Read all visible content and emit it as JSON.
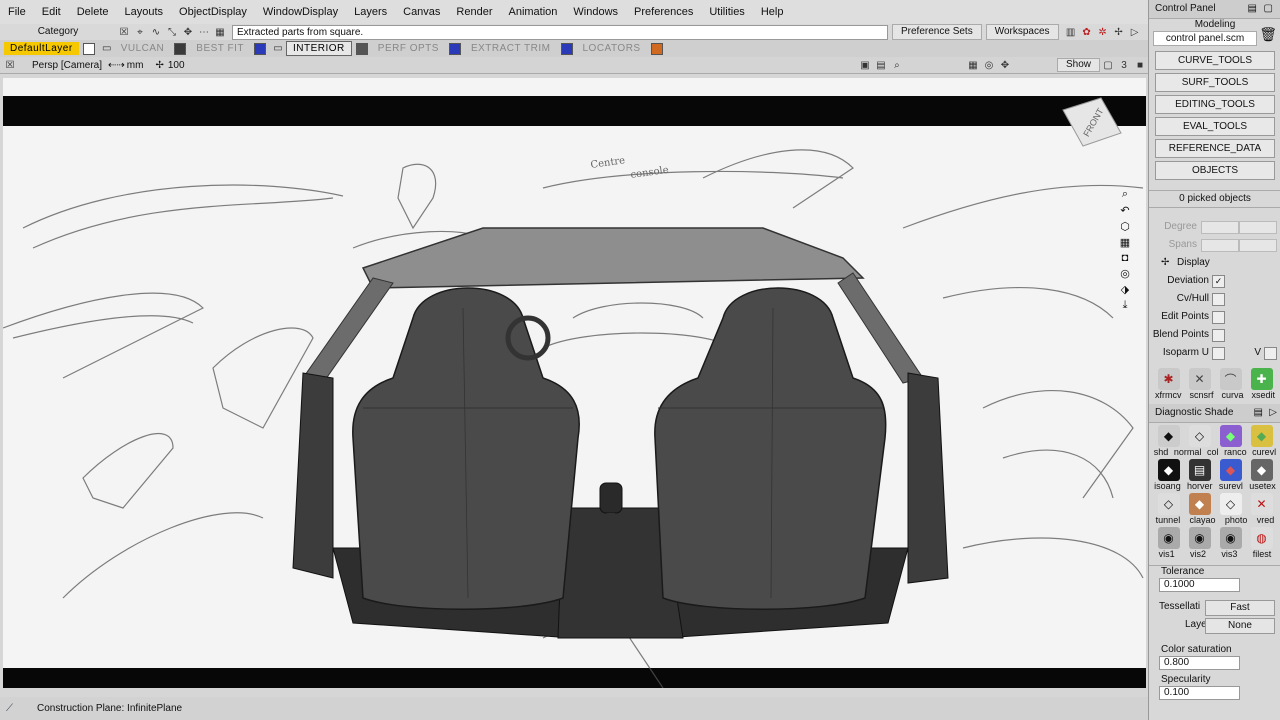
{
  "menu": [
    "File",
    "Edit",
    "Delete",
    "Layouts",
    "ObjectDisplay",
    "WindowDisplay",
    "Layers",
    "Canvas",
    "Render",
    "Animation",
    "Windows",
    "Preferences",
    "Utilities",
    "Help"
  ],
  "toolbar": {
    "category": "Category",
    "status_message": "Extracted parts from square.",
    "preference_sets": "Preference Sets",
    "workspaces": "Workspaces"
  },
  "layers": {
    "default": "DefaultLayer",
    "items": [
      {
        "label": "VULCAN",
        "color": "#3a3a3a"
      },
      {
        "label": "BEST FIT",
        "color": "#2a3ab8"
      },
      {
        "label": "INTERIOR",
        "color": "#555555"
      },
      {
        "label": "PERF OPTS",
        "color": "#2a3ab8"
      },
      {
        "label": "EXTRACT TRIM",
        "color": "#2a3ab8"
      },
      {
        "label": "LOCATORS",
        "color": "#d06a20"
      }
    ]
  },
  "viewport": {
    "camera": "Persp [Camera]",
    "units": "mm",
    "grid_value": "100",
    "show_label": "Show",
    "cube_label": "FRONT",
    "sketch_note_1": "Centre",
    "sketch_note_2": "console"
  },
  "statusbar": {
    "construction_plane": "Construction Plane: InfinitePlane"
  },
  "panel": {
    "title": "Control Panel",
    "mode": "Modeling",
    "file": "control panel.scm",
    "tool_buttons": [
      "CURVE_TOOLS",
      "SURF_TOOLS",
      "EDITING_TOOLS",
      "EVAL_TOOLS",
      "REFERENCE_DATA",
      "OBJECTS"
    ],
    "picked": "0 picked objects",
    "degree_label": "Degree",
    "spans_label": "Spans",
    "display_label": "Display",
    "display_rows": [
      {
        "label": "Deviation",
        "checked": true
      },
      {
        "label": "Cv/Hull",
        "checked": false
      },
      {
        "label": "Edit Points",
        "checked": false
      },
      {
        "label": "Blend Points",
        "checked": false
      },
      {
        "label": "Isoparm U",
        "checked": false
      }
    ],
    "isoparm_v": "V",
    "shelf1": [
      "xfrmcv",
      "scnsrf",
      "curva",
      "xsedit"
    ],
    "diag_title": "Diagnostic Shade",
    "diag_row1": [
      "shd",
      "normal",
      "col",
      "ranco",
      "curevl"
    ],
    "diag_row2": [
      "isoang",
      "horver",
      "surevl",
      "usetex"
    ],
    "diag_row3": [
      "tunnel",
      "clayao",
      "photo",
      "vred"
    ],
    "diag_row4": [
      "vis1",
      "vis2",
      "vis3",
      "filest"
    ],
    "tolerance_label": "Tolerance",
    "tolerance_value": "0.1000",
    "tessellation_label": "Tessellati",
    "tessellation_value": "Fast",
    "layer_label": "Layer",
    "layer_value": "None",
    "color_sat_label": "Color saturation",
    "color_sat_value": "0.800",
    "specularity_label": "Specularity",
    "specularity_value": "0.100"
  }
}
